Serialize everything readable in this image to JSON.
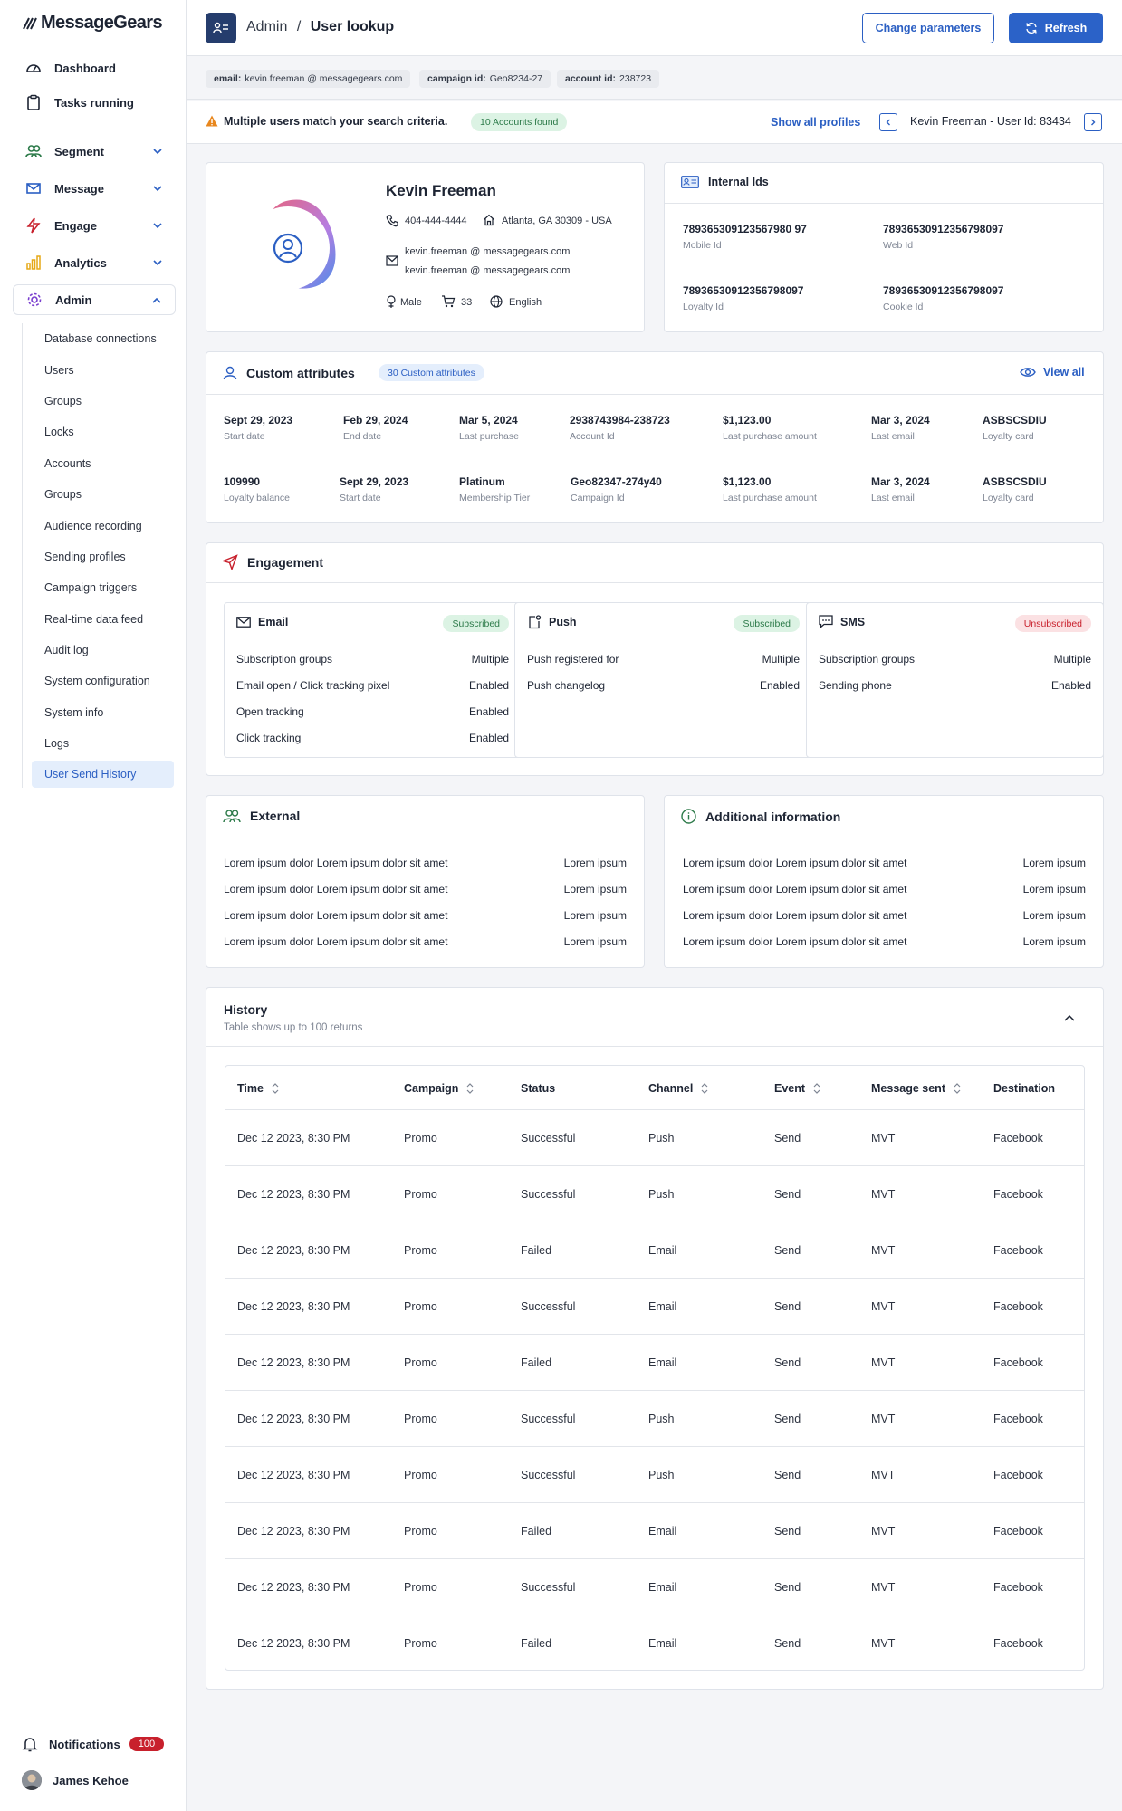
{
  "app": {
    "logo_text": "MessageGears"
  },
  "sidebar": {
    "top_items": [
      {
        "label": "Dashboard",
        "icon": "gauge-icon"
      },
      {
        "label": "Tasks running",
        "icon": "clipboard-icon"
      }
    ],
    "sections": [
      {
        "label": "Segment",
        "icon": "users-icon",
        "color": "#2c7a49"
      },
      {
        "label": "Message",
        "icon": "envelope-icon",
        "color": "#2b5fc3"
      },
      {
        "label": "Engage",
        "icon": "lightning-icon",
        "color": "#c8202c"
      },
      {
        "label": "Analytics",
        "icon": "bar-chart-icon",
        "color": "#e6a817"
      },
      {
        "label": "Admin",
        "icon": "gear-icon",
        "color": "#7a3fcf"
      }
    ],
    "admin_items": [
      "Database connections",
      "Users",
      "Groups",
      "Locks",
      "Accounts",
      "Groups",
      "Audience recording",
      "Sending profiles",
      "Campaign triggers",
      "Real-time data feed",
      "Audit log",
      "System configuration",
      "System info",
      "Logs",
      "User Send History"
    ],
    "notifications_label": "Notifications",
    "notifications_count": "100",
    "user_name": "James Kehoe"
  },
  "header": {
    "crumb_root": "Admin",
    "crumb_sep": "/",
    "crumb_current": "User lookup",
    "change_label": "Change parameters",
    "refresh_label": "Refresh"
  },
  "chips": [
    {
      "key": "email:",
      "value": "kevin.freeman @ messagegears.com"
    },
    {
      "key": "campaign id:",
      "value": "Geo8234-27"
    },
    {
      "key": "account id:",
      "value": "238723"
    }
  ],
  "alert": {
    "message": "Multiple users match your search criteria.",
    "badge": "10 Accounts found",
    "show_all": "Show all profiles",
    "current_profile": "Kevin Freeman - User Id: 83434"
  },
  "profile": {
    "name": "Kevin Freeman",
    "phone": "404-444-4444",
    "location": "Atlanta, GA 30309 - USA",
    "email1": "kevin.freeman @ messagegears.com",
    "email2": "kevin.freeman @ messagegears.com",
    "gender": "Male",
    "orders": "33",
    "language": "English"
  },
  "internal_ids": {
    "title": "Internal Ids",
    "items": [
      {
        "value": "789365309123567980 97",
        "label": "Mobile Id"
      },
      {
        "value": "78936530912356798097",
        "label": "Web Id"
      },
      {
        "value": "78936530912356798097",
        "label": "Loyalty Id"
      },
      {
        "value": "78936530912356798097",
        "label": "Cookie Id"
      }
    ]
  },
  "custom_attributes": {
    "title": "Custom attributes",
    "badge": "30 Custom attributes",
    "view_all": "View all",
    "row1": [
      {
        "value": "Sept 29, 2023",
        "label": "Start date"
      },
      {
        "value": "Feb 29, 2024",
        "label": "End date"
      },
      {
        "value": "Mar 5, 2024",
        "label": "Last purchase"
      },
      {
        "value": "2938743984-238723",
        "label": "Account Id"
      },
      {
        "value": "$1,123.00",
        "label": "Last purchase amount"
      },
      {
        "value": "Mar 3, 2024",
        "label": "Last email"
      },
      {
        "value": "ASBSCSDIU",
        "label": "Loyalty card"
      }
    ],
    "row2": [
      {
        "value": "109990",
        "label": "Loyalty balance"
      },
      {
        "value": "Sept 29, 2023",
        "label": "Start date"
      },
      {
        "value": "Platinum",
        "label": "Membership Tier"
      },
      {
        "value": "Geo82347-274y40",
        "label": "Campaign Id"
      },
      {
        "value": "$1,123.00",
        "label": "Last purchase amount"
      },
      {
        "value": "Mar 3, 2024",
        "label": "Last email"
      },
      {
        "value": "ASBSCSDIU",
        "label": "Loyalty card"
      }
    ]
  },
  "engagement": {
    "title": "Engagement",
    "channels": [
      {
        "name": "Email",
        "status": "Subscribed",
        "rows": [
          [
            "Subscription groups",
            "Multiple"
          ],
          [
            "Email open / Click tracking pixel",
            "Enabled"
          ],
          [
            "Open tracking",
            "Enabled"
          ],
          [
            "Click tracking",
            "Enabled"
          ]
        ]
      },
      {
        "name": "Push",
        "status": "Subscribed",
        "rows": [
          [
            "Push registered for",
            "Multiple"
          ],
          [
            "Push changelog",
            "Enabled"
          ]
        ]
      },
      {
        "name": "SMS",
        "status": "Unsubscribed",
        "rows": [
          [
            "Subscription groups",
            "Multiple"
          ],
          [
            "Sending phone",
            "Enabled"
          ]
        ]
      }
    ]
  },
  "external": {
    "title": "External",
    "rows": [
      [
        "Lorem ipsum dolor Lorem ipsum dolor sit amet",
        "Lorem ipsum"
      ],
      [
        "Lorem ipsum dolor Lorem ipsum dolor sit amet",
        "Lorem ipsum"
      ],
      [
        "Lorem ipsum dolor Lorem ipsum dolor sit amet",
        "Lorem ipsum"
      ],
      [
        "Lorem ipsum dolor Lorem ipsum dolor sit amet",
        "Lorem ipsum"
      ]
    ]
  },
  "additional": {
    "title": "Additional information",
    "rows": [
      [
        "Lorem ipsum dolor Lorem ipsum dolor sit amet",
        "Lorem ipsum"
      ],
      [
        "Lorem ipsum dolor Lorem ipsum dolor sit amet",
        "Lorem ipsum"
      ],
      [
        "Lorem ipsum dolor Lorem ipsum dolor sit amet",
        "Lorem ipsum"
      ],
      [
        "Lorem ipsum dolor Lorem ipsum dolor sit amet",
        "Lorem ipsum"
      ]
    ]
  },
  "history": {
    "title": "History",
    "subtitle": "Table shows up to 100 returns",
    "columns": [
      "Time",
      "Campaign",
      "Status",
      "Channel",
      "Event",
      "Message sent",
      "Destination"
    ],
    "rows": [
      [
        "Dec 12 2023, 8:30 PM",
        "Promo",
        "Successful",
        "Push",
        "Send",
        "MVT",
        "Facebook"
      ],
      [
        "Dec 12 2023, 8:30 PM",
        "Promo",
        "Successful",
        "Push",
        "Send",
        "MVT",
        "Facebook"
      ],
      [
        "Dec 12 2023, 8:30 PM",
        "Promo",
        "Failed",
        "Email",
        "Send",
        "MVT",
        "Facebook"
      ],
      [
        "Dec 12 2023, 8:30 PM",
        "Promo",
        "Successful",
        "Email",
        "Send",
        "MVT",
        "Facebook"
      ],
      [
        "Dec 12 2023, 8:30 PM",
        "Promo",
        "Failed",
        "Email",
        "Send",
        "MVT",
        "Facebook"
      ],
      [
        "Dec 12 2023, 8:30 PM",
        "Promo",
        "Successful",
        "Push",
        "Send",
        "MVT",
        "Facebook"
      ],
      [
        "Dec 12 2023, 8:30 PM",
        "Promo",
        "Successful",
        "Push",
        "Send",
        "MVT",
        "Facebook"
      ],
      [
        "Dec 12 2023, 8:30 PM",
        "Promo",
        "Failed",
        "Email",
        "Send",
        "MVT",
        "Facebook"
      ],
      [
        "Dec 12 2023, 8:30 PM",
        "Promo",
        "Successful",
        "Email",
        "Send",
        "MVT",
        "Facebook"
      ],
      [
        "Dec 12 2023, 8:30 PM",
        "Promo",
        "Failed",
        "Email",
        "Send",
        "MVT",
        "Facebook"
      ]
    ]
  }
}
